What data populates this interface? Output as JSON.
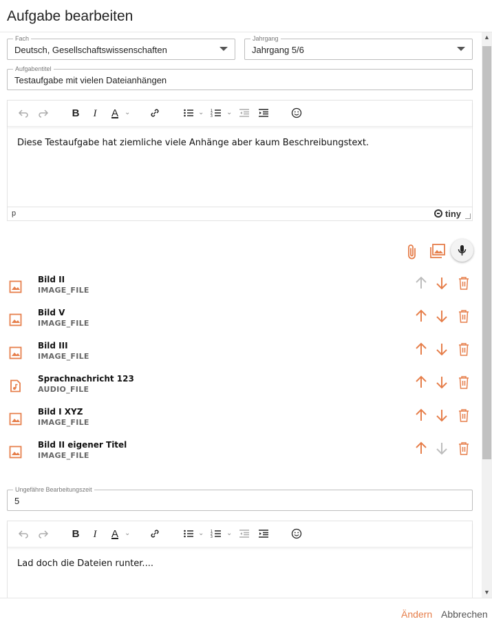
{
  "dialog": {
    "title": "Aufgabe bearbeiten"
  },
  "form": {
    "fach": {
      "label": "Fach",
      "value": "Deutsch, Gesellschaftswissenschaften"
    },
    "jahrgang": {
      "label": "Jahrgang",
      "value": "Jahrgang 5/6"
    },
    "titel": {
      "label": "Aufgabentitel",
      "value": "Testaufgabe mit vielen Dateianhängen"
    },
    "description": {
      "text": "Diese Testaufgabe hat ziemliche viele Anhänge aber kaum Beschreibungstext.",
      "status_path": "p",
      "brand": "tiny"
    },
    "zeit": {
      "label": "Ungefähre Bearbeitungszeit",
      "value": "5"
    },
    "solution": {
      "text": "Lad doch die Dateien runter...."
    }
  },
  "toolbar": {
    "bold": "B",
    "italic": "I",
    "text_color": "A"
  },
  "attachments": [
    {
      "title": "Bild II",
      "type": "IMAGE_FILE",
      "icon": "image-icon",
      "up_enabled": false,
      "down_enabled": true
    },
    {
      "title": "Bild V",
      "type": "IMAGE_FILE",
      "icon": "image-icon",
      "up_enabled": true,
      "down_enabled": true
    },
    {
      "title": "Bild III",
      "type": "IMAGE_FILE",
      "icon": "image-icon",
      "up_enabled": true,
      "down_enabled": true
    },
    {
      "title": "Sprachnachricht 123",
      "type": "AUDIO_FILE",
      "icon": "audio-file-icon",
      "up_enabled": true,
      "down_enabled": true
    },
    {
      "title": "Bild I XYZ",
      "type": "IMAGE_FILE",
      "icon": "image-icon",
      "up_enabled": true,
      "down_enabled": true
    },
    {
      "title": "Bild II eigener Titel",
      "type": "IMAGE_FILE",
      "icon": "image-icon",
      "up_enabled": true,
      "down_enabled": false
    }
  ],
  "footer": {
    "save_label": "Ändern",
    "cancel_label": "Abbrechen"
  },
  "colors": {
    "accent": "#e67e4a",
    "disabled": "#bdbdbd"
  }
}
